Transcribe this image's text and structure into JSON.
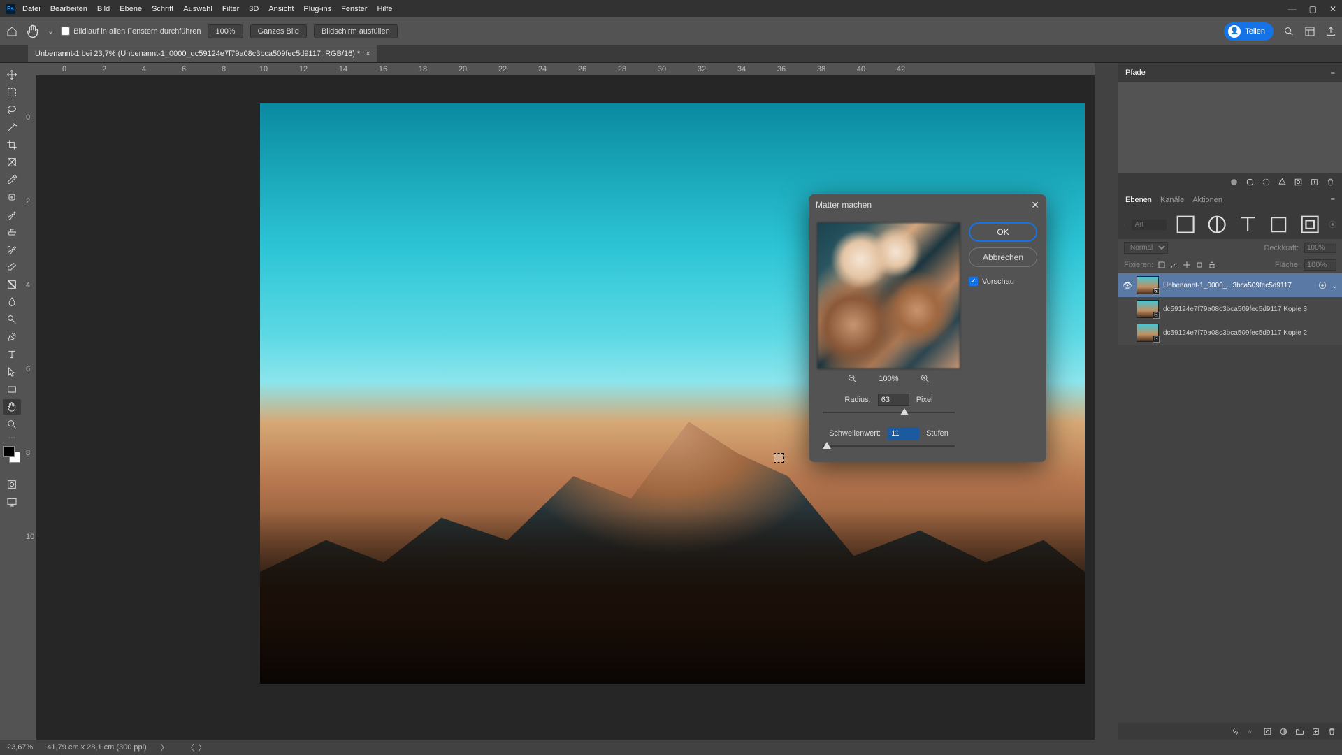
{
  "menu": [
    "Datei",
    "Bearbeiten",
    "Bild",
    "Ebene",
    "Schrift",
    "Auswahl",
    "Filter",
    "3D",
    "Ansicht",
    "Plug-ins",
    "Fenster",
    "Hilfe"
  ],
  "options": {
    "scroll_all": "Bildlauf in allen Fenstern durchführen",
    "zoom": "100%",
    "fit_image": "Ganzes Bild",
    "fill_screen": "Bildschirm ausfüllen",
    "share": "Teilen"
  },
  "doc_tab": {
    "title": "Unbenannt-1 bei 23,7% (Unbenannt-1_0000_dc59124e7f79a08c3bca509fec5d9117, RGB/16) *"
  },
  "ruler_h": [
    "0",
    "2",
    "4",
    "6",
    "8",
    "10",
    "12",
    "14",
    "16",
    "18",
    "20",
    "22",
    "24",
    "26",
    "28",
    "30",
    "32",
    "34",
    "36",
    "38",
    "40",
    "42"
  ],
  "ruler_v": [
    "0",
    "2",
    "4",
    "6",
    "8",
    "10"
  ],
  "dialog": {
    "title": "Matter machen",
    "ok": "OK",
    "cancel": "Abbrechen",
    "preview_label": "Vorschau",
    "zoom": "100%",
    "radius_label": "Radius:",
    "radius_value": "63",
    "radius_unit": "Pixel",
    "threshold_label": "Schwellenwert:",
    "threshold_value": "11",
    "threshold_unit": "Stufen"
  },
  "panels": {
    "paths_tab": "Pfade",
    "layers_tabs": [
      "Ebenen",
      "Kanäle",
      "Aktionen"
    ],
    "kind_placeholder": "Art",
    "blend_mode": "Normal",
    "opacity_label": "Deckkraft:",
    "opacity_value": "100%",
    "fix_label": "Fixieren:",
    "fill_label": "Fläche:",
    "fill_value": "100%",
    "layers": [
      {
        "name": "Unbenannt-1_0000_...3bca509fec5d9117",
        "visible": true,
        "selected": true,
        "smart": true
      },
      {
        "name": "dc59124e7f79a08c3bca509fec5d9117 Kopie 3",
        "visible": false,
        "selected": false,
        "smart": false
      },
      {
        "name": "dc59124e7f79a08c3bca509fec5d9117 Kopie 2",
        "visible": false,
        "selected": false,
        "smart": false
      }
    ]
  },
  "status": {
    "zoom": "23,67%",
    "dims": "41,79 cm x 28,1 cm (300 ppi)"
  }
}
